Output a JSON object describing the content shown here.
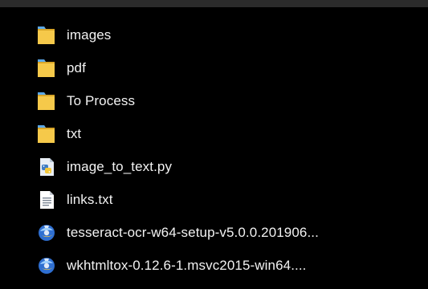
{
  "files": [
    {
      "name": "images",
      "type": "folder",
      "icon": "folder-icon"
    },
    {
      "name": "pdf",
      "type": "folder",
      "icon": "folder-icon"
    },
    {
      "name": "To Process",
      "type": "folder",
      "icon": "folder-icon"
    },
    {
      "name": "txt",
      "type": "folder",
      "icon": "folder-icon"
    },
    {
      "name": "image_to_text.py",
      "type": "python",
      "icon": "python-file-icon"
    },
    {
      "name": "links.txt",
      "type": "text",
      "icon": "text-file-icon"
    },
    {
      "name": "tesseract-ocr-w64-setup-v5.0.0.201906...",
      "type": "installer",
      "icon": "installer-icon"
    },
    {
      "name": "wkhtmltox-0.12.6-1.msvc2015-win64....",
      "type": "installer",
      "icon": "installer-icon"
    }
  ],
  "colors": {
    "background": "#000000",
    "text": "#f2f2f2",
    "folder": "#f6c94a",
    "folder_dark": "#d9a527",
    "folder_tab": "#5aa7e8"
  }
}
